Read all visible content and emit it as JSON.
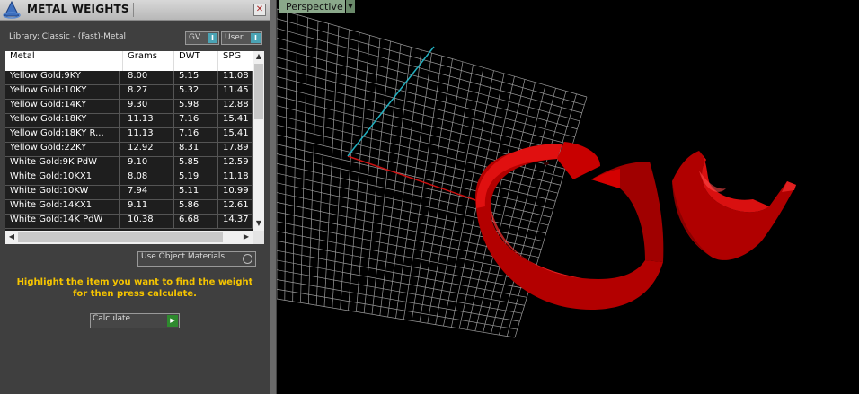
{
  "panel": {
    "title": "METAL WEIGHTS",
    "close_label": "✕",
    "library_label": "Library: Classic - (Fast)-Metal",
    "toggle_gv": "GV",
    "toggle_user": "User",
    "toggle_on_glyph": "I",
    "table": {
      "headers": [
        "Metal",
        "Grams",
        "DWT",
        "SPG"
      ],
      "rows": [
        [
          "Yellow Gold:9KY",
          "8.00",
          "5.15",
          "11.08"
        ],
        [
          "Yellow Gold:10KY",
          "8.27",
          "5.32",
          "11.45"
        ],
        [
          "Yellow Gold:14KY",
          "9.30",
          "5.98",
          "12.88"
        ],
        [
          "Yellow Gold:18KY",
          "11.13",
          "7.16",
          "15.41"
        ],
        [
          "Yellow Gold:18KY R...",
          "11.13",
          "7.16",
          "15.41"
        ],
        [
          "Yellow Gold:22KY",
          "12.92",
          "8.31",
          "17.89"
        ],
        [
          "White Gold:9K PdW",
          "9.10",
          "5.85",
          "12.59"
        ],
        [
          "White Gold:10KX1",
          "8.08",
          "5.19",
          "11.18"
        ],
        [
          "White Gold:10KW",
          "7.94",
          "5.11",
          "10.99"
        ],
        [
          "White Gold:14KX1",
          "9.11",
          "5.86",
          "12.61"
        ],
        [
          "White Gold:14K PdW",
          "10.38",
          "6.68",
          "14.37"
        ]
      ]
    },
    "use_object_materials": "Use Object Materials",
    "hint": "Highlight the item you want to find the weight for then press calculate.",
    "calculate_label": "Calculate",
    "calculate_glyph": "▶"
  },
  "viewport": {
    "view_label": "Perspective",
    "dropdown_glyph": "▼"
  },
  "colors": {
    "hint_text": "#f5c400",
    "ring": "#cc0000",
    "axis_x": "#cc1111",
    "axis_y": "#22b0c0",
    "grid": "#9a9a9a"
  }
}
